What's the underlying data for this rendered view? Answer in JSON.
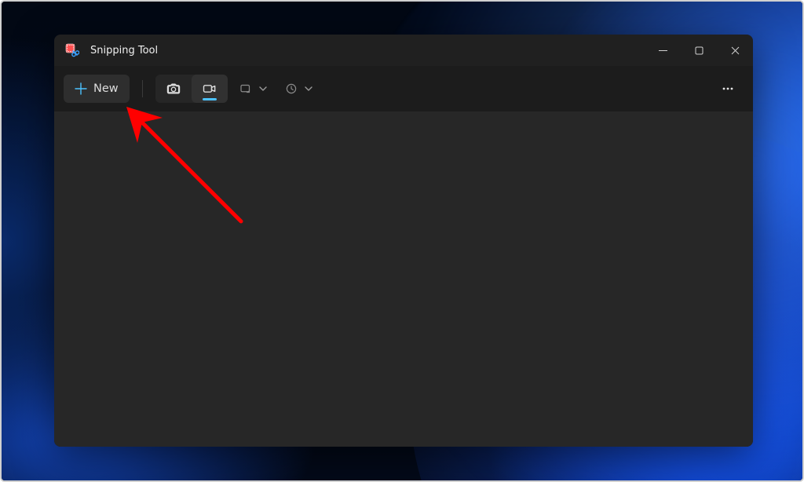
{
  "app": {
    "title": "Snipping Tool"
  },
  "toolbar": {
    "new_label": "New"
  }
}
